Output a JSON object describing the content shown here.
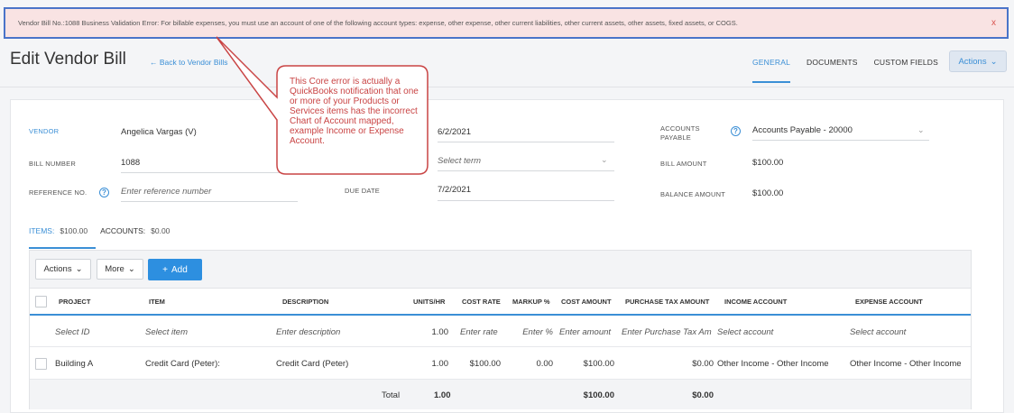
{
  "banner": {
    "message": "Vendor Bill No.:1088 Business Validation Error: For billable expenses, you must use an account of one of the following account types: expense, other expense, other current liabilities, other current assets, other assets, fixed assets, or COGS.",
    "close": "x"
  },
  "header": {
    "title": "Edit Vendor Bill",
    "back_link": "← Back to Vendor Bills",
    "tabs": [
      {
        "label": "GENERAL"
      },
      {
        "label": "DOCUMENTS"
      },
      {
        "label": "CUSTOM FIELDS"
      }
    ],
    "actions_label": "Actions"
  },
  "callout": {
    "text": "This Core error is actually a QuickBooks notification that one or more of your Products or Services items has the incorrect Chart of Account mapped, example Income or Expense Account."
  },
  "form": {
    "vendor_label": "VENDOR",
    "vendor_value": "Angelica Vargas (V)",
    "bill_number_label": "BILL NUMBER",
    "bill_number_value": "1088",
    "reference_label": "REFERENCE NO.",
    "reference_placeholder": "Enter reference number",
    "bill_date_value": "6/2/2021",
    "terms_placeholder": "Select term",
    "due_date_label": "DUE DATE",
    "due_date_value": "7/2/2021",
    "accounts_payable_label_1": "ACCOUNTS",
    "accounts_payable_label_2": "PAYABLE",
    "accounts_payable_value": "Accounts Payable - 20000",
    "bill_amount_label": "BILL AMOUNT",
    "bill_amount_value": "$100.00",
    "balance_amount_label": "BALANCE AMOUNT",
    "balance_amount_value": "$100.00",
    "help": "?"
  },
  "summary": {
    "items_label": "ITEMS:",
    "items_value": "$100.00",
    "accounts_label": "ACCOUNTS:",
    "accounts_value": "$0.00"
  },
  "toolbar": {
    "actions_label": "Actions",
    "more_label": "More",
    "add_label": "Add"
  },
  "table": {
    "headers": {
      "project": "PROJECT",
      "item": "ITEM",
      "description": "DESCRIPTION",
      "units": "UNITS/HR",
      "cost_rate": "COST RATE",
      "markup": "MARKUP %",
      "cost_amount": "COST AMOUNT",
      "purchase_tax": "PURCHASE TAX AMOUNT",
      "income_account": "INCOME ACCOUNT",
      "expense_account": "EXPENSE ACCOUNT"
    },
    "entry_row": {
      "project": "Select ID",
      "item": "Select item",
      "description": "Enter description",
      "units": "1.00",
      "cost_rate": "Enter rate",
      "markup": "Enter %",
      "cost_amount": "Enter amount",
      "purchase_tax": "Enter Purchase Tax Am",
      "income_account": "Select account",
      "expense_account": "Select account"
    },
    "rows": [
      {
        "project": "Building A",
        "item": "Credit Card (Peter):",
        "description": "Credit Card (Peter)",
        "units": "1.00",
        "cost_rate": "$100.00",
        "markup": "0.00",
        "cost_amount": "$100.00",
        "purchase_tax": "$0.00",
        "income_account": "Other Income - Other Income",
        "expense_account": "Other Income - Other Income"
      }
    ],
    "total": {
      "label": "Total",
      "units": "1.00",
      "cost_amount": "$100.00",
      "purchase_tax": "$0.00"
    }
  }
}
